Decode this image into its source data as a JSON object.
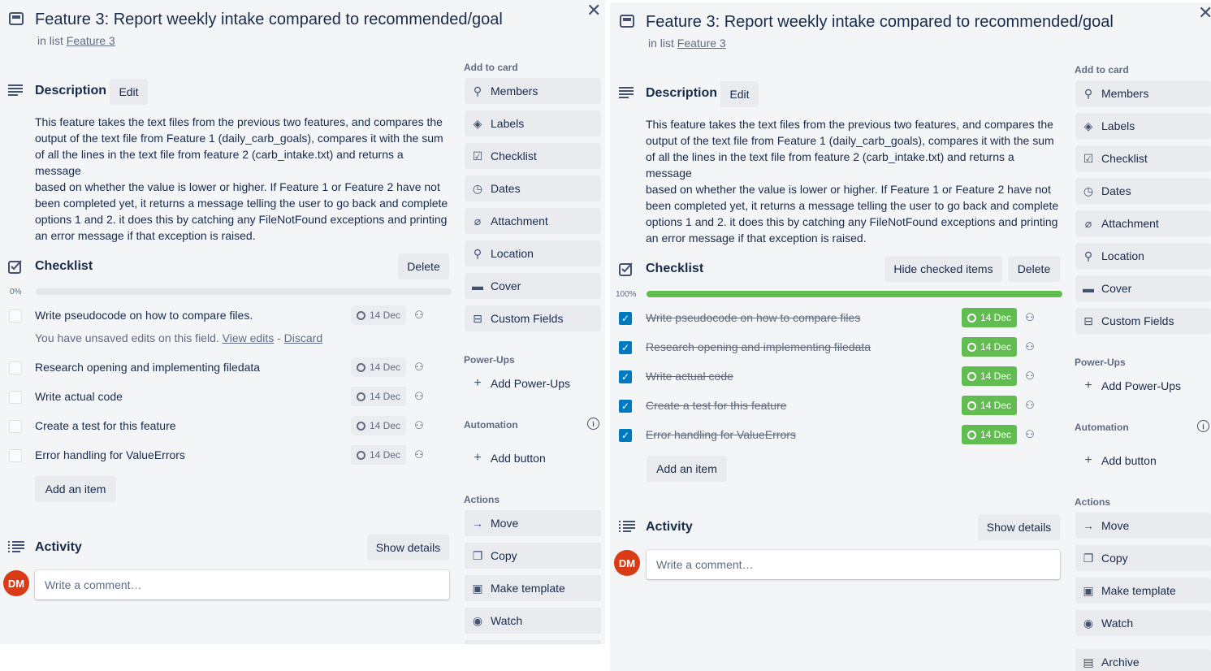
{
  "left": {
    "title": "Feature 3: Report weekly intake compared to recommended/goal",
    "in_list_prefix": "in list",
    "list_name": "Feature 3",
    "description_heading": "Description",
    "edit_label": "Edit",
    "description_lines": [
      "This feature takes the text files from the previous two features, and compares the",
      "output of the text file from Feature 1 (daily_carb_goals), compares it with the sum",
      "of all the lines in the text file from feature 2 (carb_intake.txt) and returns a message",
      "based on whether the value is lower or higher. If Feature 1 or Feature 2 have not",
      "been completed yet, it returns a message telling the user to go back and complete",
      "options 1 and 2. it does this by catching any FileNotFound exceptions and printing",
      "an error message if that exception is raised."
    ],
    "checklist_heading": "Checklist",
    "delete_label": "Delete",
    "progress_label": "0%",
    "progress": 0,
    "items": [
      {
        "text": "Write pseudocode on how to compare files.",
        "due": "14 Dec",
        "checked": false
      },
      {
        "text": "Research opening and implementing filedata",
        "due": "14 Dec",
        "checked": false
      },
      {
        "text": "Write actual code",
        "due": "14 Dec",
        "checked": false
      },
      {
        "text": "Create a test for this feature",
        "due": "14 Dec",
        "checked": false
      },
      {
        "text": "Error handling for ValueErrors",
        "due": "14 Dec",
        "checked": false
      }
    ],
    "unsaved_note": "You have unsaved edits on this field.",
    "view_edits": "View edits",
    "dash": "-",
    "discard": "Discard",
    "add_item": "Add an item",
    "activity_heading": "Activity",
    "show_details": "Show details",
    "avatar_initials": "DM",
    "comment_placeholder": "Write a comment…",
    "sidebar": {
      "add_to_card": "Add to card",
      "add_items": [
        {
          "label": "Members",
          "icon": "person-icon"
        },
        {
          "label": "Labels",
          "icon": "tag-icon"
        },
        {
          "label": "Checklist",
          "icon": "checkbox-icon"
        },
        {
          "label": "Dates",
          "icon": "clock-icon"
        },
        {
          "label": "Attachment",
          "icon": "paperclip-icon"
        },
        {
          "label": "Location",
          "icon": "pin-icon"
        },
        {
          "label": "Cover",
          "icon": "cover-icon"
        },
        {
          "label": "Custom Fields",
          "icon": "fields-icon"
        }
      ],
      "power_ups": "Power-Ups",
      "add_power_ups": "Add Power-Ups",
      "automation": "Automation",
      "add_button": "Add button",
      "actions": "Actions",
      "action_items": [
        {
          "label": "Move",
          "icon": "arrow-icon"
        },
        {
          "label": "Copy",
          "icon": "copy-icon"
        },
        {
          "label": "Make template",
          "icon": "template-icon"
        },
        {
          "label": "Watch",
          "icon": "eye-icon"
        }
      ]
    }
  },
  "right": {
    "title": "Feature 3: Report weekly intake compared to recommended/goal",
    "in_list_prefix": "in list",
    "list_name": "Feature 3",
    "description_heading": "Description",
    "edit_label": "Edit",
    "description_lines": [
      "This feature takes the text files from the previous two features, and compares the",
      "output of the text file from Feature 1 (daily_carb_goals), compares it with the sum",
      "of all the lines in the text file from feature 2 (carb_intake.txt) and returns a message",
      "based on whether the value is lower or higher. If Feature 1 or Feature 2 have not",
      "been completed yet, it returns a message telling the user to go back and complete",
      "options 1 and 2. it does this by catching any FileNotFound exceptions and printing",
      "an error message if that exception is raised."
    ],
    "checklist_heading": "Checklist",
    "hide_checked": "Hide checked items",
    "delete_label": "Delete",
    "progress_label": "100%",
    "progress": 1,
    "items": [
      {
        "text": "Write pseudocode on how to compare files",
        "due": "14 Dec",
        "checked": true
      },
      {
        "text": "Research opening and implementing filedata",
        "due": "14 Dec",
        "checked": true
      },
      {
        "text": "Write actual code",
        "due": "14 Dec",
        "checked": true
      },
      {
        "text": "Create a test for this feature",
        "due": "14 Dec",
        "checked": true
      },
      {
        "text": "Error handling for ValueErrors",
        "due": "14 Dec",
        "checked": true
      }
    ],
    "add_item": "Add an item",
    "activity_heading": "Activity",
    "show_details": "Show details",
    "avatar_initials": "DM",
    "comment_placeholder": "Write a comment…",
    "sidebar": {
      "add_to_card": "Add to card",
      "add_items": [
        {
          "label": "Members",
          "icon": "person-icon"
        },
        {
          "label": "Labels",
          "icon": "tag-icon"
        },
        {
          "label": "Checklist",
          "icon": "checkbox-icon"
        },
        {
          "label": "Dates",
          "icon": "clock-icon"
        },
        {
          "label": "Attachment",
          "icon": "paperclip-icon"
        },
        {
          "label": "Location",
          "icon": "pin-icon"
        },
        {
          "label": "Cover",
          "icon": "cover-icon"
        },
        {
          "label": "Custom Fields",
          "icon": "fields-icon"
        }
      ],
      "power_ups": "Power-Ups",
      "add_power_ups": "Add Power-Ups",
      "automation": "Automation",
      "add_button": "Add button",
      "actions": "Actions",
      "action_items": [
        {
          "label": "Move",
          "icon": "arrow-icon"
        },
        {
          "label": "Copy",
          "icon": "copy-icon"
        },
        {
          "label": "Make template",
          "icon": "template-icon"
        },
        {
          "label": "Watch",
          "icon": "eye-icon"
        },
        {
          "label": "Archive",
          "icon": "archive-icon"
        }
      ]
    },
    "colors": {
      "checked": "#0079bf",
      "progress_complete": "#61bd4f",
      "due_complete": "#61bd4f"
    }
  }
}
